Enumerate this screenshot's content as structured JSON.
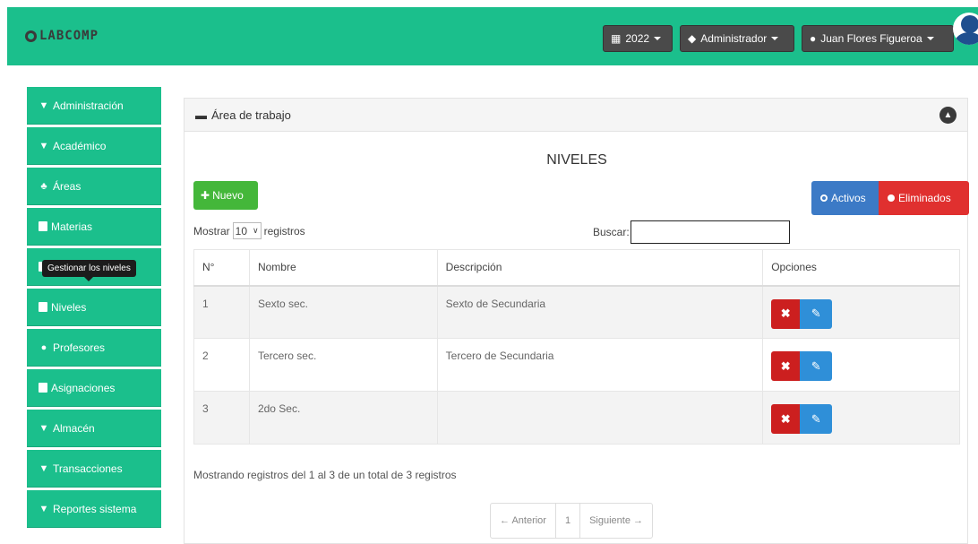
{
  "topbar": {
    "brand": "LABCOMP",
    "year_label": "2022",
    "role_label": "Administrador",
    "user_label": "Juan Flores Figueroa"
  },
  "sidebar": {
    "items": [
      {
        "label": "Administración",
        "icon": "chevron-down-icon"
      },
      {
        "label": "Académico",
        "icon": "chevron-down-icon"
      },
      {
        "label": "Áreas",
        "icon": "users-icon"
      },
      {
        "label": "Materias",
        "icon": "book-icon"
      },
      {
        "label": "",
        "icon": "list-icon"
      },
      {
        "label": "Niveles",
        "icon": "bookmark-icon"
      },
      {
        "label": "Profesores",
        "icon": "user-icon"
      },
      {
        "label": "Asignaciones",
        "icon": "calendar-icon"
      },
      {
        "label": "Almacén",
        "icon": "chevron-down-icon"
      },
      {
        "label": "Transacciones",
        "icon": "chevron-down-icon"
      },
      {
        "label": "Reportes sistema",
        "icon": "chevron-down-icon"
      }
    ],
    "tooltip": "Gestionar los niveles"
  },
  "panel": {
    "header": "Área de trabajo",
    "title": "NIVELES",
    "new_button": "Nuevo",
    "activos_label": "Activos",
    "eliminados_label": "Eliminados",
    "show_prefix": "Mostrar",
    "show_value": "10",
    "show_suffix": "registros",
    "search_label": "Buscar:",
    "search_value": ""
  },
  "table": {
    "headers": [
      "N°",
      "Nombre",
      "Descripción",
      "Opciones"
    ],
    "rows": [
      {
        "n": "1",
        "nombre": "Sexto sec.",
        "descripcion": "Sexto de Secundaria"
      },
      {
        "n": "2",
        "nombre": "Tercero sec.",
        "descripcion": "Tercero de Secundaria"
      },
      {
        "n": "3",
        "nombre": "2do Sec.",
        "descripcion": ""
      }
    ]
  },
  "footer": {
    "info": "Mostrando registros del 1 al 3 de un total de 3 registros",
    "prev": "← Anterior",
    "page": "1",
    "next": "Siguiente →"
  },
  "colors": {
    "accent": "#1bbf8c",
    "dark_button": "#4a4a4a",
    "new_green": "#44b73a",
    "activos_blue": "#3c7ac6",
    "eliminados_red": "#e0302f"
  }
}
